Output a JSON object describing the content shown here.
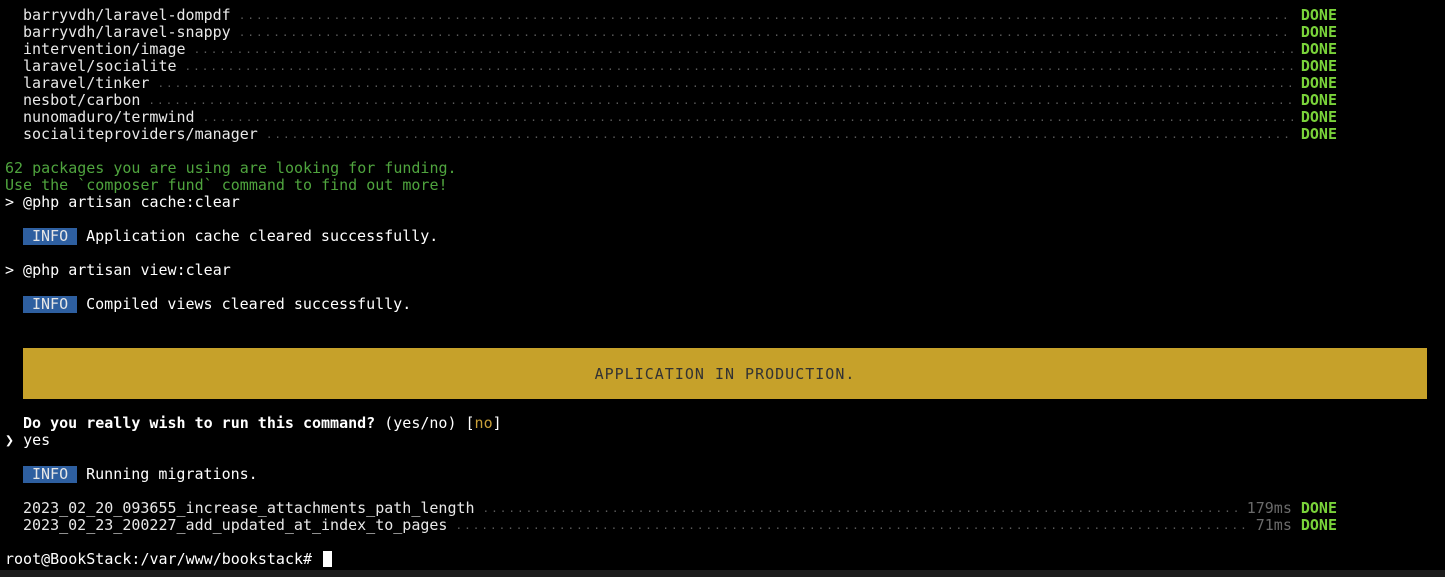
{
  "packages": [
    {
      "name": "barryvdh/laravel-dompdf",
      "status": "DONE"
    },
    {
      "name": "barryvdh/laravel-snappy",
      "status": "DONE"
    },
    {
      "name": "intervention/image",
      "status": "DONE"
    },
    {
      "name": "laravel/socialite",
      "status": "DONE"
    },
    {
      "name": "laravel/tinker",
      "status": "DONE"
    },
    {
      "name": "nesbot/carbon",
      "status": "DONE"
    },
    {
      "name": "nunomaduro/termwind",
      "status": "DONE"
    },
    {
      "name": "socialiteproviders/manager",
      "status": "DONE"
    }
  ],
  "funding": {
    "line1": "62 packages you are using are looking for funding.",
    "line2": "Use the `composer fund` command to find out more!"
  },
  "commands": {
    "cache_clear": "> @php artisan cache:clear",
    "view_clear": "> @php artisan view:clear"
  },
  "info": {
    "badge": "INFO",
    "cache_msg": "Application cache cleared successfully.",
    "views_msg": "Compiled views cleared successfully.",
    "migrations_msg": "Running migrations."
  },
  "banner": "APPLICATION IN PRODUCTION.",
  "prompt": {
    "question": "Do you really wish to run this command?",
    "options": "(yes/no) [",
    "default": "no",
    "close": "]",
    "answer_marker": "❯",
    "answer": "yes"
  },
  "migrations": [
    {
      "name": "2023_02_20_093655_increase_attachments_path_length",
      "duration": "179ms",
      "status": "DONE"
    },
    {
      "name": "2023_02_23_200227_add_updated_at_index_to_pages",
      "duration": "71ms",
      "status": "DONE"
    }
  ],
  "shell_prompt": "root@BookStack:/var/www/bookstack#",
  "colors": {
    "background": "#000000",
    "done": "#7ad33a",
    "funding": "#4fa43e",
    "badge": "#2e5fa0",
    "banner": "#c6a12a"
  }
}
